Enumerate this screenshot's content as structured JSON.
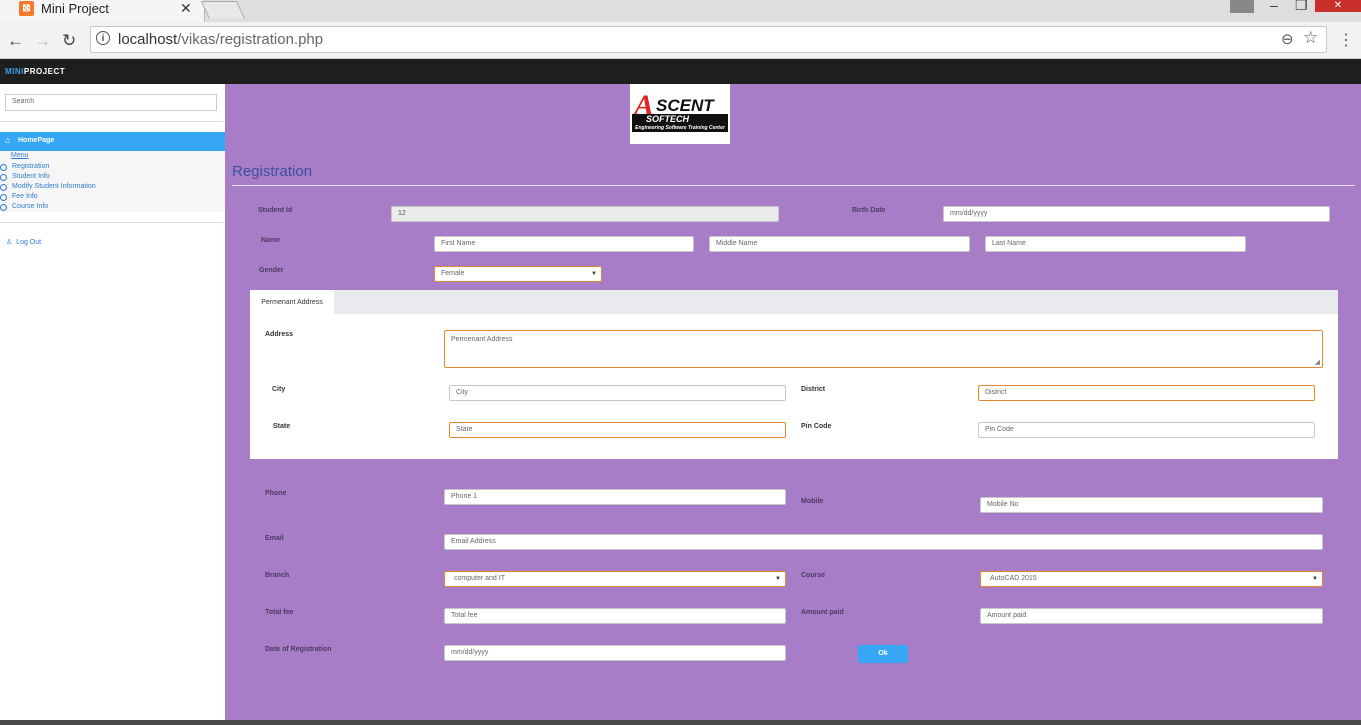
{
  "browser": {
    "tab_title": "Mini Project",
    "tab_close": "✕",
    "url_host": "localhost",
    "url_path": "/vikas/registration.php"
  },
  "app": {
    "brand_mini": "MINI",
    "brand_project": "PROJECT"
  },
  "sidebar": {
    "search_placeholder": "Search",
    "home": "HomePage",
    "menu_head": "Menu",
    "items": [
      "Registration",
      "Student Info",
      "Modify Student Information",
      "Fee Info",
      "Course Info"
    ],
    "logout": "Log Out"
  },
  "logo": {
    "a": "A",
    "scent": "SCENT",
    "softech": "SOFTECH",
    "tagline": "Engineering Software Training Center"
  },
  "page": {
    "title": "Registration"
  },
  "form": {
    "student_id_label": "Student Id",
    "student_id_value": "12",
    "birth_date_label": "Birth Date",
    "birth_date_value": "mm/dd/yyyy",
    "name_label": "Name",
    "first_name_ph": "First Name",
    "middle_name_ph": "Middle Name",
    "last_name_ph": "Last Name",
    "gender_label": "Gender",
    "gender_value": "Female",
    "address_tab": "Permenant Address",
    "address_label": "Address",
    "address_ph": "Permenant Address",
    "city_label": "City",
    "city_ph": "City",
    "district_label": "District",
    "district_ph": "District",
    "state_label": "State",
    "state_ph": "State",
    "pincode_label": "Pin Code",
    "pincode_ph": "Pin Code",
    "phone_label": "Phone",
    "phone_ph": "Phone 1",
    "mobile_label": "Mobile",
    "mobile_ph": "Mobile No",
    "email_label": "Email",
    "email_ph": "Email Address",
    "branch_label": "Branch",
    "branch_value": "computer and IT",
    "course_label": "Course",
    "course_value": "AutoCAD 2015",
    "total_fee_label": "Total fee",
    "total_fee_ph": "Total fee",
    "amount_paid_label": "Amount paid",
    "amount_paid_ph": "Amount paid",
    "reg_date_label": "Date of Registration",
    "reg_date_value": "mm/dd/yyyy",
    "ok_button": "Ok"
  },
  "colors": {
    "main_bg": "#a87dc8",
    "accent": "#35a7f5",
    "title": "#3d4fa4"
  }
}
